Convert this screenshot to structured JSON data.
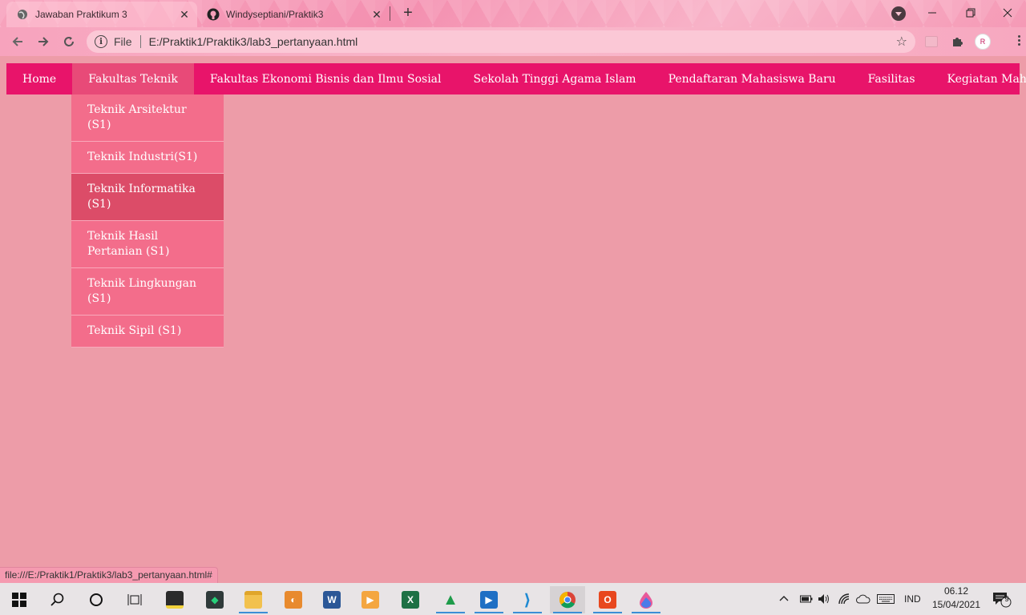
{
  "browser": {
    "tabs": [
      {
        "title": "Jawaban Praktikum 3",
        "active": true
      },
      {
        "title": "Windyseptiani/Praktik3",
        "active": false
      }
    ],
    "address": {
      "scheme": "File",
      "url": "E:/Praktik1/Praktik3/lab3_pertanyaan.html"
    },
    "avatar_text": "R"
  },
  "page": {
    "menu": [
      {
        "label": "Home"
      },
      {
        "label": "Fakultas Teknik",
        "active": true
      },
      {
        "label": "Fakultas Ekonomi Bisnis dan Ilmu Sosial"
      },
      {
        "label": "Sekolah Tinggi Agama Islam"
      },
      {
        "label": "Pendaftaran Mahasiswa Baru"
      },
      {
        "label": "Fasilitas"
      },
      {
        "label": "Kegiatan Mahasiswa"
      }
    ],
    "dropdown": [
      {
        "label": "Teknik Arsitektur (S1)"
      },
      {
        "label": "Teknik Industri(S1)"
      },
      {
        "label": "Teknik Informatika (S1)",
        "hover": true
      },
      {
        "label": "Teknik Hasil Pertanian (S1)"
      },
      {
        "label": "Teknik Lingkungan (S1)"
      },
      {
        "label": "Teknik Sipil (S1)"
      }
    ],
    "status_url": "file:///E:/Praktik1/Praktik3/lab3_pertanyaan.html#"
  },
  "taskbar": {
    "language": "IND",
    "time": "06.12",
    "date": "15/04/2021",
    "notification_count": "9"
  },
  "colors": {
    "menubar": "#e8146a",
    "dropdown": "#f36d8b",
    "dropdown_hover": "#dc4c68",
    "page_bg": "#ed9ca8"
  }
}
